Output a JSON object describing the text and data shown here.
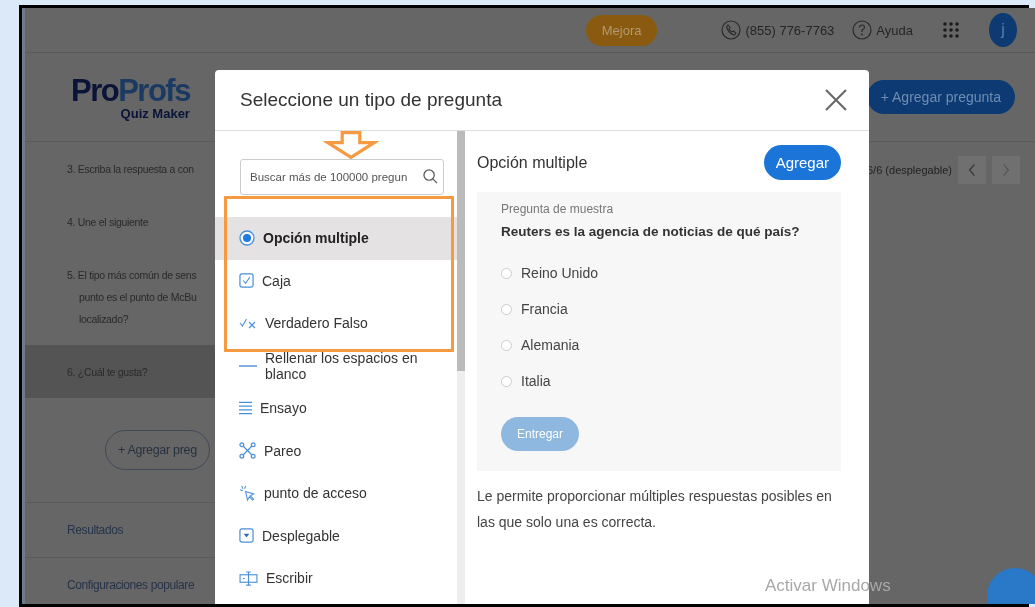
{
  "header": {
    "upgrade_button": "Mejora",
    "phone": "(855) 776-7763",
    "help": "Ayuda",
    "avatar": "j"
  },
  "logo": {
    "brand_first": "Pro",
    "brand_second": "Profs",
    "product": "Quiz Maker"
  },
  "add_question_button": "+ Agregar pregunta",
  "pager": "6/6 (desplegable)",
  "questions": [
    {
      "lines": [
        "3. Escriba la respuesta a con"
      ],
      "selected": false
    },
    {
      "lines": [
        "4. Une el siguiente"
      ],
      "selected": false
    },
    {
      "lines": [
        "5. El tipo más común de sens",
        "punto es el punto de McBu",
        "localizado?"
      ],
      "selected": false
    },
    {
      "lines": [
        "6. ¿Cuál te gusta?"
      ],
      "selected": true
    }
  ],
  "add_question_bottom": "+ Agregar preg",
  "sections": [
    "Resultados",
    "Configuraciones populare"
  ],
  "modal": {
    "title": "Seleccione un tipo de pregunta",
    "search": {
      "placeholder": "Buscar más de 100000 pregun"
    },
    "types": [
      {
        "kind": "radio",
        "label": "Opción multiple",
        "selected": true
      },
      {
        "kind": "checkbox",
        "label": "Caja",
        "selected": false
      },
      {
        "kind": "truefalse",
        "label": "Verdadero Falso",
        "selected": false
      },
      {
        "kind": "blank",
        "label": "Rellenar los espacios en blanco",
        "selected": false
      },
      {
        "kind": "essay",
        "label": "Ensayo",
        "selected": false
      },
      {
        "kind": "matching",
        "label": "Pareo",
        "selected": false
      },
      {
        "kind": "hotspot",
        "label": "punto de acceso",
        "selected": false
      },
      {
        "kind": "dropdown",
        "label": "Desplegable",
        "selected": false
      },
      {
        "kind": "typing",
        "label": "Escribir",
        "selected": false
      }
    ],
    "preview": {
      "title": "Opción multiple",
      "add_button": "Agregar",
      "sample_label": "Pregunta de muestra",
      "question": "Reuters es la agencia de noticias de qué país?",
      "options": [
        {
          "label": "Reino Unido",
          "checked": false
        },
        {
          "label": "Francia",
          "checked": false
        },
        {
          "label": "Alemania",
          "checked": false
        },
        {
          "label": "Italia",
          "checked": false
        }
      ],
      "submit": {
        "label": "Entregar",
        "disabled": true
      },
      "description": "Le permite proporcionar múltiples respuestas posibles en las que solo una es correcta."
    }
  },
  "os_notice": "Activar Windows"
}
